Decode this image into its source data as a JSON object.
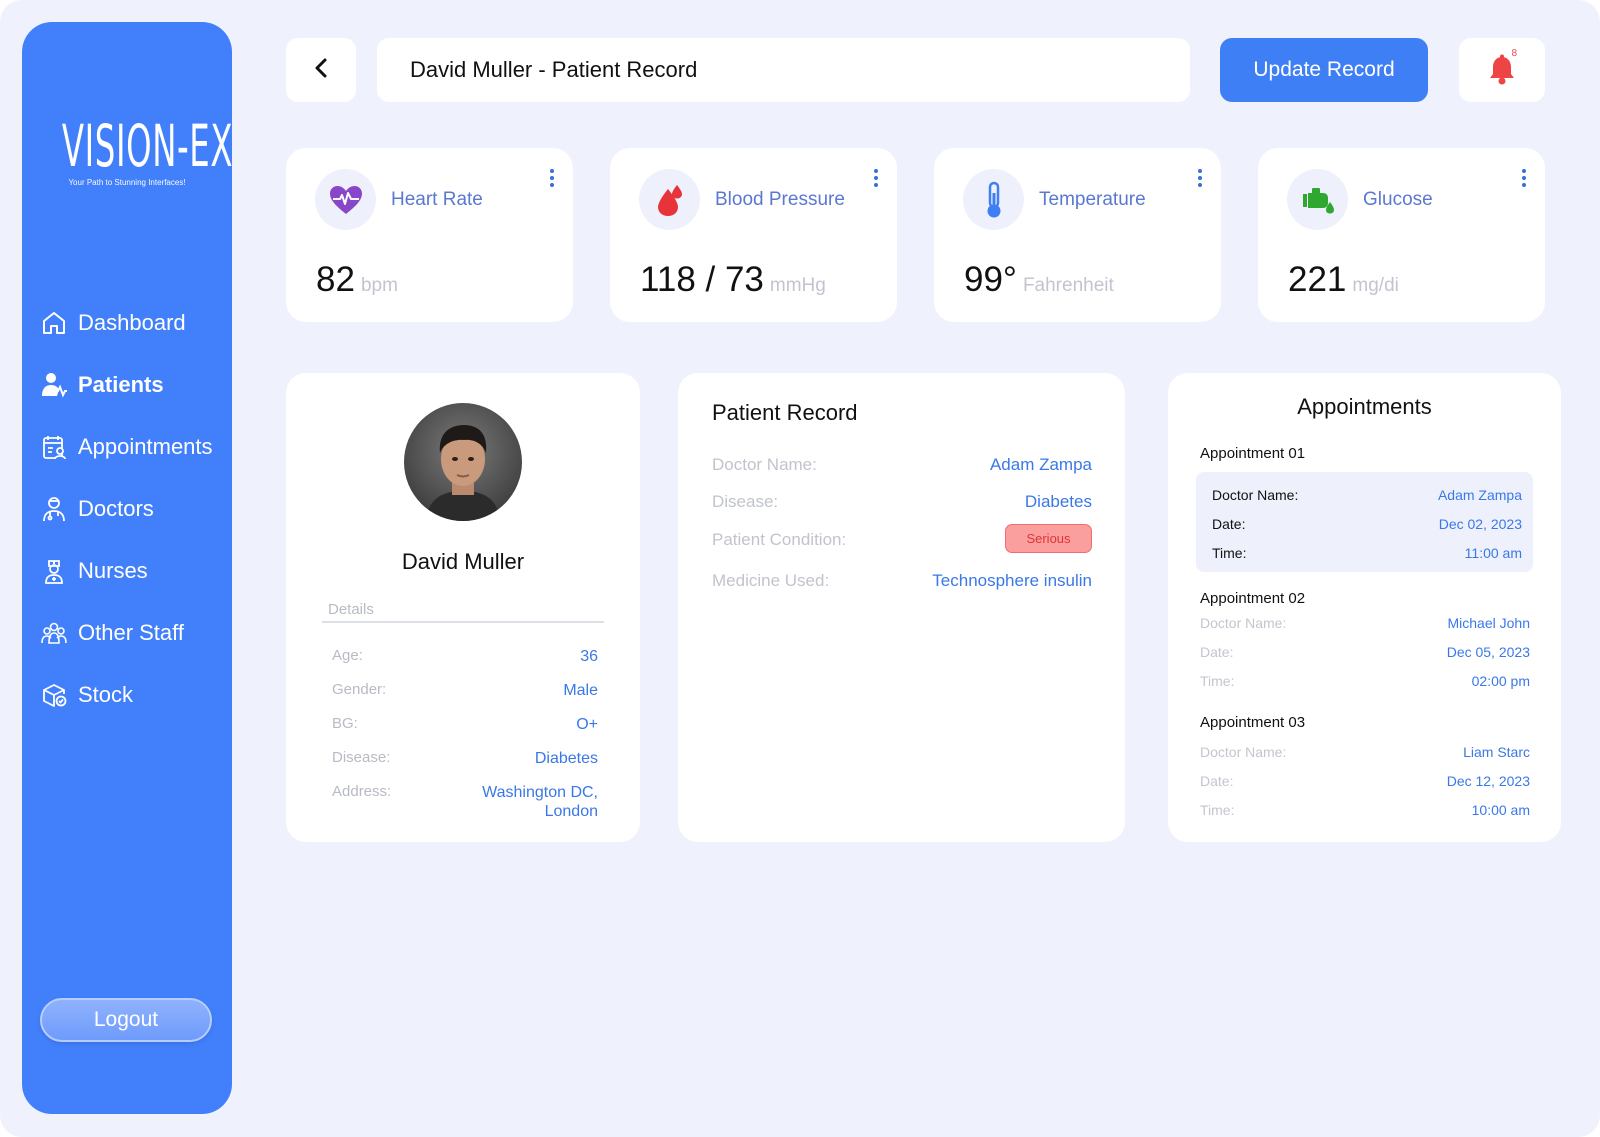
{
  "brand": {
    "name": "VISION-EX",
    "tagline": "Your Path to Stunning Interfaces!"
  },
  "sidebar": {
    "items": [
      {
        "label": "Dashboard",
        "icon": "home-icon"
      },
      {
        "label": "Patients",
        "icon": "patients-icon",
        "active": true
      },
      {
        "label": "Appointments",
        "icon": "calendar-person-icon"
      },
      {
        "label": "Doctors",
        "icon": "doctor-icon"
      },
      {
        "label": "Nurses",
        "icon": "nurse-icon"
      },
      {
        "label": "Other Staff",
        "icon": "staff-icon"
      },
      {
        "label": "Stock",
        "icon": "box-icon"
      }
    ],
    "logout_label": "Logout"
  },
  "header": {
    "title": "David Muller - Patient Record",
    "update_label": "Update Record",
    "notification_count": "8"
  },
  "vitals": [
    {
      "label": "Heart Rate",
      "value": "82",
      "unit": "bpm",
      "icon": "heart-pulse-icon",
      "icon_color": "#8a46c8"
    },
    {
      "label": "Blood Pressure",
      "value": "118 / 73",
      "unit": "mmHg",
      "icon": "blood-drop-icon",
      "icon_color": "#e8333a"
    },
    {
      "label": "Temperature",
      "value": "99°",
      "unit": "Fahrenheit",
      "icon": "thermometer-icon",
      "icon_color": "#3f7ff6"
    },
    {
      "label": "Glucose",
      "value": "221",
      "unit": "mg/di",
      "icon": "glucose-meter-icon",
      "icon_color": "#2fa82f"
    }
  ],
  "profile": {
    "name": "David Muller",
    "details_label": "Details",
    "rows": [
      {
        "key": "Age:",
        "value": "36"
      },
      {
        "key": "Gender:",
        "value": "Male"
      },
      {
        "key": "BG:",
        "value": "O+"
      },
      {
        "key": "Disease:",
        "value": "Diabetes"
      },
      {
        "key": "Address:",
        "value": "Washington DC,",
        "value2": "London"
      }
    ]
  },
  "record": {
    "title": "Patient Record",
    "rows": [
      {
        "key": "Doctor Name:",
        "value": "Adam Zampa"
      },
      {
        "key": "Disease:",
        "value": "Diabetes"
      },
      {
        "key": "Patient Condition:",
        "value": "Serious"
      },
      {
        "key": "Medicine Used:",
        "value": "Technosphere insulin"
      }
    ]
  },
  "appointments": {
    "title": "Appointments",
    "items": [
      {
        "heading": "Appointment 01",
        "doctor_key": "Doctor Name:",
        "doctor": "Adam Zampa",
        "date_key": "Date:",
        "date": "Dec 02, 2023",
        "time_key": "Time:",
        "time": "11:00 am"
      },
      {
        "heading": "Appointment 02",
        "doctor_key": "Doctor Name:",
        "doctor": "Michael John",
        "date_key": "Date:",
        "date": "Dec 05, 2023",
        "time_key": "Time:",
        "time": "02:00 pm"
      },
      {
        "heading": "Appointment 03",
        "doctor_key": "Doctor Name:",
        "doctor": "Liam Starc",
        "date_key": "Date:",
        "date": "Dec 12, 2023",
        "time_key": "Time:",
        "time": "10:00 am"
      }
    ]
  },
  "colors": {
    "primary": "#4280fb",
    "accent_text": "#3a78e8",
    "background": "#eff2fc",
    "danger": "#e03535"
  }
}
